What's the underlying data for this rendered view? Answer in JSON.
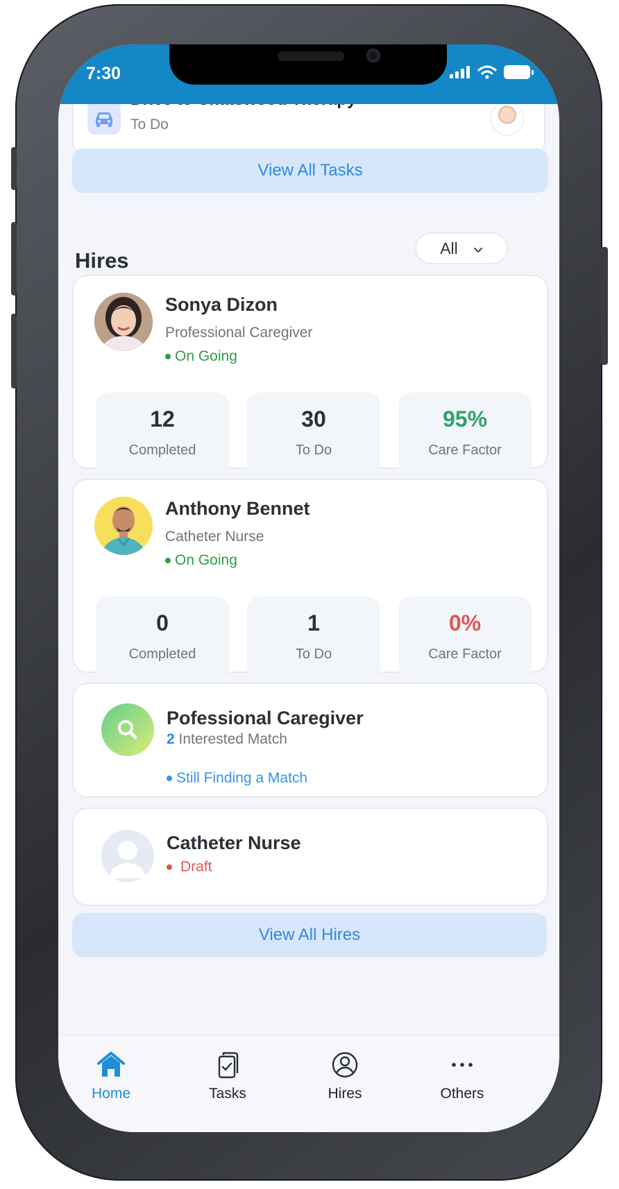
{
  "status_bar": {
    "time": "7:30"
  },
  "task_preview": {
    "title": "Drive to Chatswood Therapy",
    "status": "To Do"
  },
  "view_all_tasks_label": "View All Tasks",
  "hires_section": {
    "title": "Hires",
    "filter_value": "All"
  },
  "hires": [
    {
      "name": "Sonya Dizon",
      "role": "Professional Caregiver",
      "status": "On Going",
      "completed": "12",
      "completed_label": "Completed",
      "todo": "30",
      "todo_label": "To Do",
      "care_factor": "95%",
      "care_factor_label": "Care Factor",
      "care_factor_color": "#2ea36a"
    },
    {
      "name": "Anthony Bennet",
      "role": "Catheter Nurse",
      "status": "On Going",
      "completed": "0",
      "completed_label": "Completed",
      "todo": "1",
      "todo_label": "To Do",
      "care_factor": "0%",
      "care_factor_color": "#e25555",
      "care_factor_label": "Care Factor"
    }
  ],
  "job_posts": [
    {
      "title": "Pofessional Caregiver",
      "match_count": "2",
      "match_label": "Interested Match",
      "status": "Still Finding a Match",
      "status_color": "#3a92f0"
    },
    {
      "title": "Catheter Nurse",
      "status": "Draft",
      "status_color": "#e25555"
    }
  ],
  "view_all_hires_label": "View All Hires",
  "tabbar": {
    "items": [
      {
        "label": "Home",
        "icon": "home-icon",
        "active": true
      },
      {
        "label": "Tasks",
        "icon": "clipboard-icon"
      },
      {
        "label": "Hires",
        "icon": "user-circle-icon"
      },
      {
        "label": "Others",
        "icon": "more-icon"
      }
    ]
  },
  "colors": {
    "accent": "#1487c7",
    "ongoing": "#2e9b4a"
  }
}
